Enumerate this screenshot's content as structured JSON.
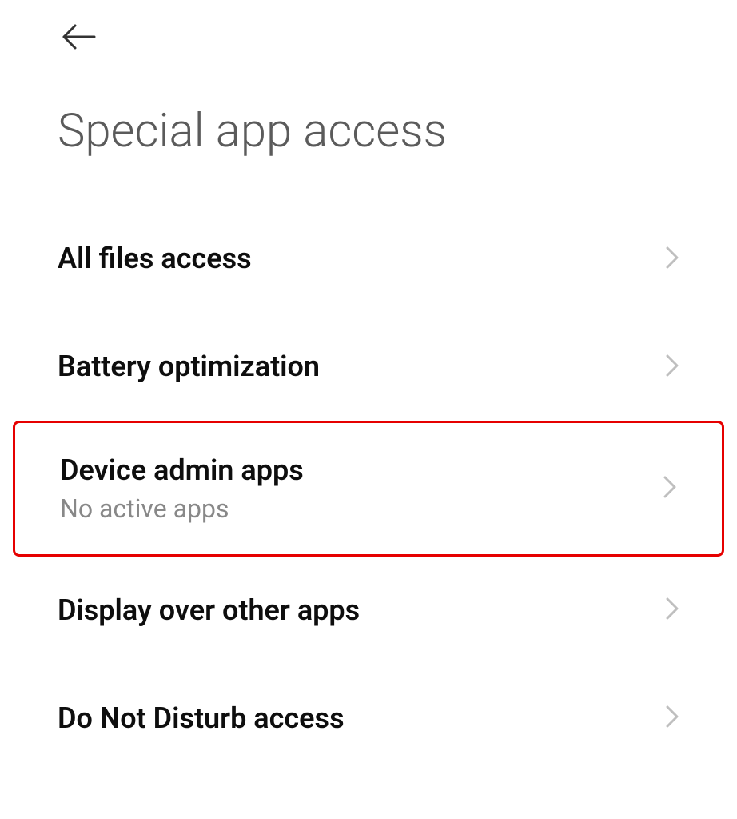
{
  "header": {
    "title": "Special app access"
  },
  "items": [
    {
      "title": "All files access",
      "subtitle": null,
      "highlighted": false
    },
    {
      "title": "Battery optimization",
      "subtitle": null,
      "highlighted": false
    },
    {
      "title": "Device admin apps",
      "subtitle": "No active apps",
      "highlighted": true
    },
    {
      "title": "Display over other apps",
      "subtitle": null,
      "highlighted": false
    },
    {
      "title": "Do Not Disturb access",
      "subtitle": null,
      "highlighted": false
    }
  ]
}
